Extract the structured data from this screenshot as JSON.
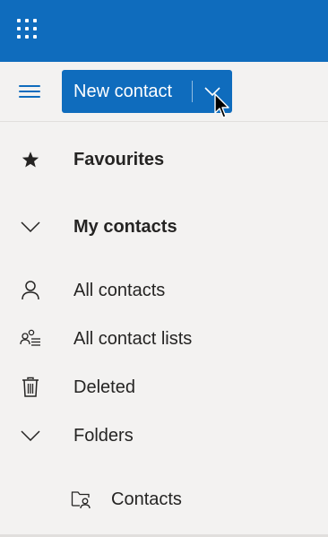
{
  "colors": {
    "brand": "#0f6cbd",
    "background": "#f3f2f1",
    "text": "#252423"
  },
  "topbar": {
    "app_launcher_icon": "waffle-icon"
  },
  "commandbar": {
    "menu_icon": "hamburger-icon",
    "new_contact_label": "New contact",
    "dropdown_icon": "chevron-down-icon"
  },
  "nav": {
    "favourites": {
      "label": "Favourites",
      "icon": "star-icon"
    },
    "my_contacts": {
      "label": "My contacts",
      "icon": "chevron-down-icon"
    },
    "all_contacts": {
      "label": "All contacts",
      "icon": "person-icon"
    },
    "all_contact_lists": {
      "label": "All contact lists",
      "icon": "people-list-icon"
    },
    "deleted": {
      "label": "Deleted",
      "icon": "trash-icon"
    },
    "folders": {
      "label": "Folders",
      "icon": "chevron-down-icon"
    },
    "contacts_folder": {
      "label": "Contacts",
      "icon": "contact-folder-icon"
    }
  }
}
